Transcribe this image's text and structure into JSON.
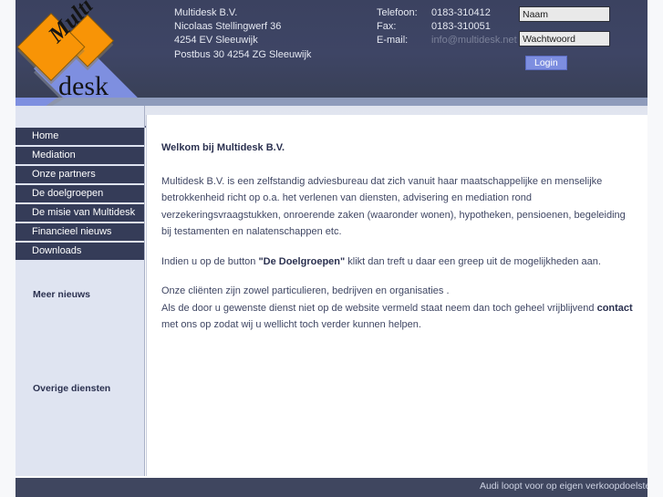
{
  "company": {
    "name": "Multidesk B.V.",
    "address_line": "Nicolaas Stellingwerf 36",
    "city_line": "4254 EV Sleeuwijk",
    "postbus_line": "Postbus 30 4254 ZG Sleeuwijk"
  },
  "contact_labels": {
    "phone": "Telefoon:",
    "fax": "Fax:",
    "email": "E-mail:"
  },
  "contact_values": {
    "phone": "0183-310412",
    "fax": "0183-310051",
    "email": "info@multidesk.net"
  },
  "login": {
    "name_value": "Naam",
    "name_placeholder": "Naam",
    "password_value": "Wachtwoord",
    "password_placeholder": "Wachtwoord",
    "button_label": "Login"
  },
  "logo": {
    "top_text": "Multi",
    "bottom_text": "desk",
    "orange": "#f89406",
    "blue": "#7e8fe0",
    "dark": "#3c4361"
  },
  "sidebar": {
    "items": [
      {
        "label": "Home"
      },
      {
        "label": "Mediation"
      },
      {
        "label": "Onze partners"
      },
      {
        "label": "De doelgroepen"
      },
      {
        "label": "De misie van Multidesk"
      },
      {
        "label": "Financieel nieuws"
      },
      {
        "label": "Downloads"
      }
    ],
    "news_heading": "Meer nieuws",
    "other_services_heading": "Overige diensten"
  },
  "main": {
    "title": "Welkom bij Multidesk B.V.",
    "p1_a": "Multidesk B.V. is een zelfstandig adviesbureau dat zich vanuit haar maatschappelijke en menselijke betrokkenheid richt op o.a. het verlenen van diensten, advisering en mediation rond verzekeringsvraagstukken, onroerende zaken (waaronder wonen), hypotheken, pensioenen, begeleiding bij testamenten en nalatenschappen etc.",
    "p2_a": "Indien u op de button ",
    "p2_bold": "\"De Doelgroepen\"",
    "p2_b": " klikt dan treft u daar een greep uit de mogelijkheden aan.",
    "p3": "Onze cliënten zijn zowel particulieren, bedrijven en organisaties .",
    "p4_a": "Als de door u gewenste dienst niet op de website vermeld staat neem dan toch geheel vrijblijvend ",
    "p4_bold": "contact",
    "p4_b": " met ons op zodat wij u wellicht toch verder kunnen helpen."
  },
  "footer": {
    "marquee_text": "Audi loopt voor op eigen verkoopdoelstelling"
  },
  "colors": {
    "header_bg": "#3c4361",
    "nav_bg": "#353c58",
    "sidebar_bg": "#dfe4f1",
    "band_mid": "#8e9bbb",
    "band_light": "#e2e6f0",
    "footer_bg": "#3f465f",
    "login_button": "#7d8ee0",
    "text": "#3f4663",
    "muted_email": "#7b8199"
  }
}
